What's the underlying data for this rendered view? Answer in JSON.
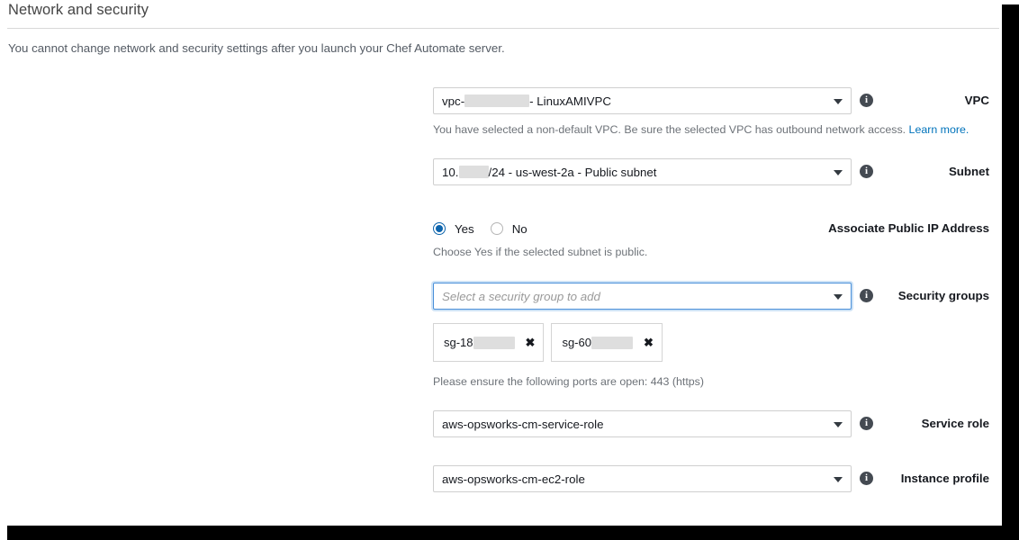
{
  "header": {
    "title": "Network and security",
    "subtitle": "You cannot change network and security settings after you launch your Chef Automate server."
  },
  "fields": {
    "vpc": {
      "label": "VPC",
      "value_prefix": "vpc-",
      "value_suffix": " - LinuxAMIVPC",
      "redacted": true,
      "hint": "You have selected a non-default VPC. Be sure the selected VPC has outbound network access. ",
      "hint_link": "Learn more."
    },
    "subnet": {
      "label": "Subnet",
      "value_prefix": "10.",
      "value_suffix": "/24 - us-west-2a - Public subnet",
      "redacted": true
    },
    "public_ip": {
      "label": "Associate Public IP Address",
      "options": [
        {
          "label": "Yes",
          "selected": true
        },
        {
          "label": "No",
          "selected": false
        }
      ],
      "hint": "Choose Yes if the selected subnet is public."
    },
    "security_groups": {
      "label": "Security groups",
      "placeholder": "Select a security group to add",
      "focused": true,
      "tokens": [
        {
          "prefix": "sg-18",
          "redacted": true,
          "remove": "✖"
        },
        {
          "prefix": "sg-60",
          "redacted": true,
          "remove": "✖"
        }
      ],
      "hint": "Please ensure the following ports are open: 443 (https)"
    },
    "service_role": {
      "label": "Service role",
      "value": "aws-opsworks-cm-service-role"
    },
    "instance_profile": {
      "label": "Instance profile",
      "value": "aws-opsworks-cm-ec2-role"
    }
  },
  "icons": {
    "info": "i",
    "caret": "chevron-down"
  },
  "colors": {
    "accent": "#0073bb",
    "radio_selected": "#0e65ad",
    "focus_border": "#4a90d9",
    "redaction": "#dedede"
  }
}
